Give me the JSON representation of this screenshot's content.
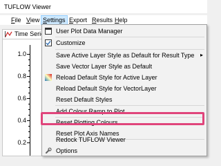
{
  "window": {
    "title": "TUFLOW Viewer"
  },
  "menubar": {
    "items": [
      {
        "label": "File"
      },
      {
        "label": "View"
      },
      {
        "label": "Settings"
      },
      {
        "label": "Export"
      },
      {
        "label": "Results"
      },
      {
        "label": "Help"
      }
    ],
    "active": "Settings",
    "active_bg": "#cce8ff"
  },
  "plot": {
    "tab_label": "Time Series",
    "tab_icon": "line-chart-icon",
    "y_ticks": [
      "1.0",
      "0.8",
      "0.6",
      "0.4",
      "0.2"
    ]
  },
  "settings_menu": {
    "items": [
      {
        "label": "User Plot Data Manager",
        "icon": "window-icon"
      },
      {
        "label": "Customize",
        "icon": "checkbox-icon"
      },
      {
        "label": "Save Active Layer Style as Default for Result Type",
        "submenu": true
      },
      {
        "label": "Save Vector Layer Style as Default"
      },
      {
        "label": "Reload Default Style for Active Layer",
        "icon": "color-ramp-icon"
      },
      {
        "label": "Reload Default Style for VectorLayer"
      },
      {
        "label": "Reset Default Styles"
      },
      {
        "label": "Add Colour Ramp to Plot"
      },
      {
        "label": "Reset Plotting Colours",
        "highlighted": true
      },
      {
        "label": "Reset Plot Axis Names"
      },
      {
        "label": "Redock TUFLOW Viewer"
      },
      {
        "label": "Options",
        "icon": "wrench-icon"
      }
    ],
    "highlight_color": "#e0457b",
    "submenu_glyph": "▸"
  }
}
